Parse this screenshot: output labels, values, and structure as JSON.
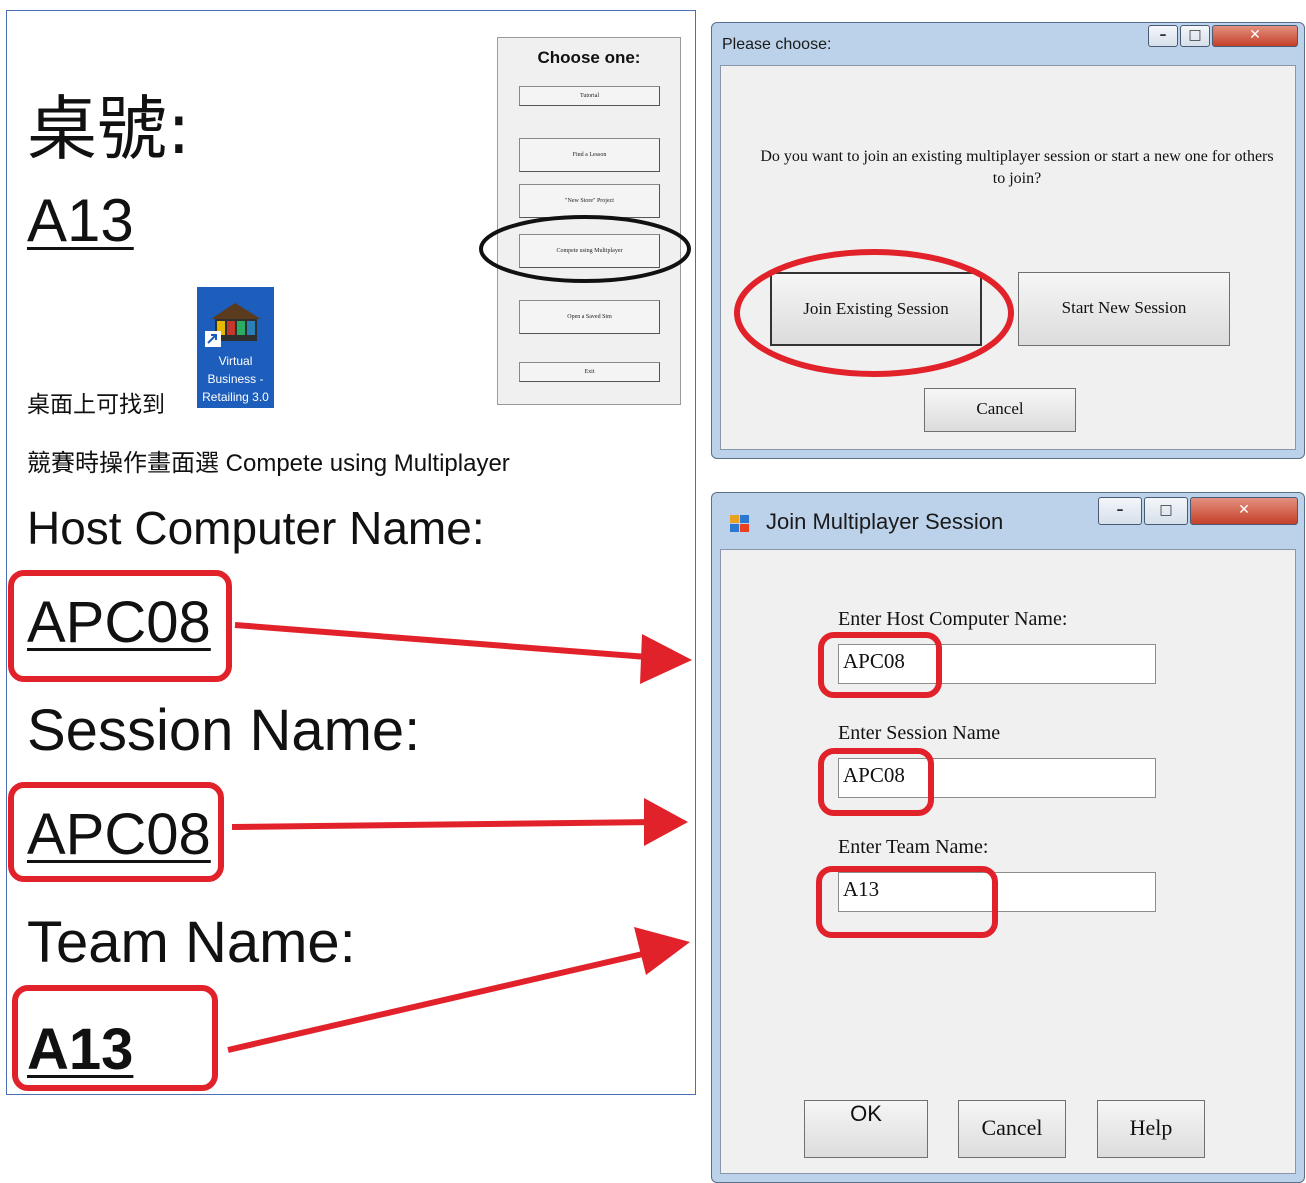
{
  "doc": {
    "table_heading": "桌號:",
    "table_number": "A13",
    "desktop_note": "桌面上可找到",
    "app_icon_label": "Virtual Business - Retailing 3.0",
    "instruction": "競賽時操作畫面選 Compete using Multiplayer",
    "host_label": "Host Computer Name:",
    "host_value": "APC08",
    "session_label": "Session Name:",
    "session_value": "APC08",
    "team_label": "Team Name:",
    "team_value": "A13"
  },
  "menu": {
    "title": "Choose one:",
    "items": [
      "Tutorial",
      "Find a Lesson",
      "\"New Store\" Project",
      "Compete using Multiplayer",
      "Open a Saved Sim",
      "Exit"
    ]
  },
  "choose_dialog": {
    "title": "Please choose:",
    "question": "Do you want to join an existing multiplayer session or start a new one for others to join?",
    "join_label": "Join Existing Session",
    "start_label": "Start New Session",
    "cancel_label": "Cancel"
  },
  "join_dialog": {
    "title": "Join Multiplayer Session",
    "host_label": "Enter Host Computer Name:",
    "host_value": "APC08",
    "session_label": "Enter Session Name",
    "session_value": "APC08",
    "team_label": "Enter Team Name:",
    "team_value": "A13",
    "ok_label": "OK",
    "cancel_label": "Cancel",
    "help_label": "Help"
  },
  "colors": {
    "highlight": "#e2222a",
    "doc_border": "#4a6fb4",
    "window_frame": "#bcd2ea",
    "dialog_bg": "#f0f0f0"
  }
}
